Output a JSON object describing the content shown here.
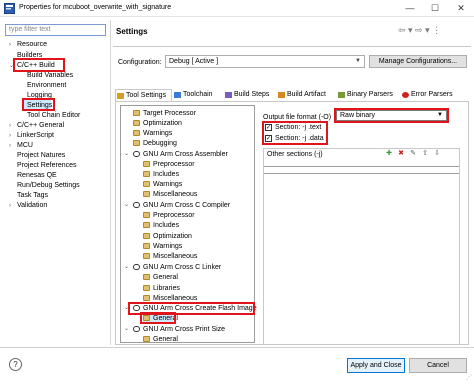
{
  "window": {
    "title": "Properties for mcuboot_overwrite_with_signature",
    "controls": [
      "—",
      "☐",
      "✕"
    ]
  },
  "left_panel": {
    "filter_placeholder": "type filter text",
    "items": [
      {
        "label": "Resource",
        "expander": "›"
      },
      {
        "label": "Builders",
        "expander": ""
      },
      {
        "label": "C/C++ Build",
        "expander": "⌄"
      },
      {
        "label": "Build Variables",
        "expander": ""
      },
      {
        "label": "Environment",
        "expander": ""
      },
      {
        "label": "Logging",
        "expander": ""
      },
      {
        "label": "Settings",
        "expander": ""
      },
      {
        "label": "Tool Chain Editor",
        "expander": ""
      },
      {
        "label": "C/C++ General",
        "expander": "›"
      },
      {
        "label": "LinkerScript",
        "expander": "›"
      },
      {
        "label": "MCU",
        "expander": "›"
      },
      {
        "label": "Project Natures",
        "expander": ""
      },
      {
        "label": "Project References",
        "expander": ""
      },
      {
        "label": "Renesas QE",
        "expander": ""
      },
      {
        "label": "Run/Debug Settings",
        "expander": ""
      },
      {
        "label": "Task Tags",
        "expander": ""
      },
      {
        "label": "Validation",
        "expander": "›"
      }
    ]
  },
  "header": {
    "title": "Settings",
    "nav": "⇦ ▾ ⇨ ▾ ⋮"
  },
  "configuration": {
    "label": "Configuration:",
    "value": "Debug  [ Active ]",
    "manage_label": "Manage Configurations..."
  },
  "tabs": [
    {
      "label": "Tool Settings",
      "icon_color": "#d4a020"
    },
    {
      "label": "Toolchain",
      "icon_color": "#3a7bd5"
    },
    {
      "label": "Build Steps",
      "icon_color": "#7a5cc2"
    },
    {
      "label": "Build Artifact",
      "icon_color": "#d48a20"
    },
    {
      "label": "Binary Parsers",
      "icon_color": "#7a9a3a"
    },
    {
      "label": "Error Parsers",
      "icon_color": "#d02020"
    }
  ],
  "tool_tree": [
    {
      "label": "Target Processor",
      "icon": "gear",
      "expander": ""
    },
    {
      "label": "Optimization",
      "icon": "gear",
      "expander": ""
    },
    {
      "label": "Warnings",
      "icon": "gear",
      "expander": ""
    },
    {
      "label": "Debugging",
      "icon": "gear",
      "expander": ""
    },
    {
      "label": "GNU Arm Cross Assembler",
      "icon": "gnu",
      "expander": "⌄"
    },
    {
      "label": "Preprocessor",
      "icon": "gear",
      "expander": ""
    },
    {
      "label": "Includes",
      "icon": "gear",
      "expander": ""
    },
    {
      "label": "Warnings",
      "icon": "gear",
      "expander": ""
    },
    {
      "label": "Miscellaneous",
      "icon": "gear",
      "expander": ""
    },
    {
      "label": "GNU Arm Cross C Compiler",
      "icon": "gnu",
      "expander": "⌄"
    },
    {
      "label": "Preprocessor",
      "icon": "gear",
      "expander": ""
    },
    {
      "label": "Includes",
      "icon": "gear",
      "expander": ""
    },
    {
      "label": "Optimization",
      "icon": "gear",
      "expander": ""
    },
    {
      "label": "Warnings",
      "icon": "gear",
      "expander": ""
    },
    {
      "label": "Miscellaneous",
      "icon": "gear",
      "expander": ""
    },
    {
      "label": "GNU Arm Cross C Linker",
      "icon": "gnu",
      "expander": "⌄"
    },
    {
      "label": "General",
      "icon": "gear",
      "expander": ""
    },
    {
      "label": "Libraries",
      "icon": "gear",
      "expander": ""
    },
    {
      "label": "Miscellaneous",
      "icon": "gear",
      "expander": ""
    },
    {
      "label": "GNU Arm Cross Create Flash Image",
      "icon": "gnu",
      "expander": "⌄"
    },
    {
      "label": "General",
      "icon": "gear",
      "expander": ""
    },
    {
      "label": "GNU Arm Cross Print Size",
      "icon": "gnu",
      "expander": "⌄"
    },
    {
      "label": "General",
      "icon": "gear",
      "expander": ""
    }
  ],
  "options": {
    "output_format_label": "Output file format (-O)",
    "output_format_value": "Raw binary",
    "section_text": {
      "label": "Section: -j .text",
      "checked": true,
      "mark": "✓"
    },
    "section_data": {
      "label": "Section: -j .data",
      "checked": true,
      "mark": "✓"
    },
    "other_sections_label": "Other sections (-j)"
  },
  "footer": {
    "help": "?",
    "apply_close": "Apply and Close",
    "cancel": "Cancel"
  },
  "colors": {
    "highlight_box": "#e0141b",
    "selection": "#cde8ff"
  }
}
